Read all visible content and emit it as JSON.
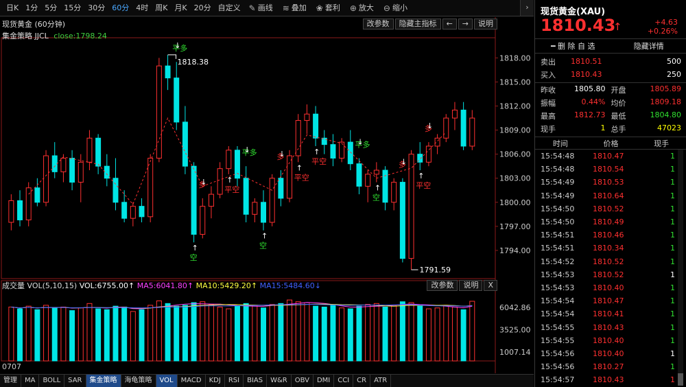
{
  "toolbar": {
    "periods": [
      "日K",
      "1分",
      "5分",
      "15分",
      "30分",
      "60分",
      "4时",
      "周K",
      "月K",
      "20分",
      "自定义"
    ],
    "active_period": "60分",
    "tools": [
      {
        "label": "画线",
        "icon": "pencil-icon"
      },
      {
        "label": "叠加",
        "icon": "layers-icon"
      },
      {
        "label": "套利",
        "icon": "bag-icon"
      },
      {
        "label": "放大",
        "icon": "zoom-in-icon"
      },
      {
        "label": "缩小",
        "icon": "zoom-out-icon"
      }
    ],
    "collapse": "›"
  },
  "main_chart": {
    "title": "现货黄金 (60分钟)",
    "indicator_name": "集金策略 JJCL",
    "indicator_close": "close:1798.24",
    "buttons": [
      "改参数",
      "隐藏主指标",
      "←",
      "→",
      "说明"
    ],
    "high_label": "1818.38",
    "low_label": "1791.59",
    "signals": [
      {
        "text": "平多",
        "kind": "pingduo"
      },
      {
        "text": "空",
        "kind": "kong"
      },
      {
        "text": "多",
        "kind": "duo"
      },
      {
        "text": "平空",
        "kind": "pingkong"
      },
      {
        "text": "平多",
        "kind": "pingduo"
      },
      {
        "text": "空",
        "kind": "kong"
      },
      {
        "text": "多",
        "kind": "duo"
      },
      {
        "text": "平空",
        "kind": "pingkong"
      },
      {
        "text": "平空",
        "kind": "pingkong"
      },
      {
        "text": "平多",
        "kind": "pingduo"
      },
      {
        "text": "空",
        "kind": "kong"
      },
      {
        "text": "多",
        "kind": "duo"
      },
      {
        "text": "平空",
        "kind": "pingkong"
      },
      {
        "text": "多",
        "kind": "duo"
      }
    ]
  },
  "volume_panel": {
    "label": "成交量 VOL(5,10,15)",
    "vol": "VOL:6755.00↑",
    "ma5": "MA5:6041.80↑",
    "ma10": "MA10:5429.20↑",
    "ma15": "MA15:5484.60↓",
    "buttons": [
      "改参数",
      "说明",
      "X"
    ],
    "date": "0707"
  },
  "chart_data": [
    {
      "type": "candlestick",
      "title": "现货黄金 (60分钟)",
      "y_ticks": [
        "1818.00",
        "1815.00",
        "1812.00",
        "1809.00",
        "1806.00",
        "1803.00",
        "1800.00",
        "1797.00",
        "1794.00"
      ],
      "ylim": [
        1791,
        1820
      ],
      "annotations": [
        "1818.38",
        "1791.59"
      ],
      "ohlc": [
        [
          1797.5,
          1801.0,
          1796.5,
          1800.2
        ],
        [
          1800.2,
          1801.5,
          1797.0,
          1797.8
        ],
        [
          1797.8,
          1802.5,
          1797.0,
          1801.8
        ],
        [
          1801.8,
          1803.0,
          1799.5,
          1800.0
        ],
        [
          1800.0,
          1806.5,
          1799.5,
          1805.8
        ],
        [
          1805.8,
          1807.5,
          1803.0,
          1803.8
        ],
        [
          1803.8,
          1806.0,
          1802.5,
          1805.5
        ],
        [
          1805.5,
          1806.5,
          1801.5,
          1802.5
        ],
        [
          1802.5,
          1806.0,
          1800.0,
          1805.0
        ],
        [
          1805.0,
          1809.0,
          1804.0,
          1808.0
        ],
        [
          1808.0,
          1808.5,
          1803.5,
          1804.5
        ],
        [
          1804.5,
          1806.0,
          1802.0,
          1803.0
        ],
        [
          1803.0,
          1805.5,
          1799.0,
          1800.0
        ],
        [
          1800.0,
          1801.5,
          1797.5,
          1798.0
        ],
        [
          1798.0,
          1800.0,
          1797.0,
          1799.5
        ],
        [
          1799.5,
          1800.5,
          1797.5,
          1798.2
        ],
        [
          1798.2,
          1806.0,
          1797.5,
          1805.5
        ],
        [
          1805.5,
          1818.0,
          1805.0,
          1817.0
        ],
        [
          1817.0,
          1818.38,
          1814.0,
          1815.5
        ],
        [
          1815.5,
          1817.5,
          1809.0,
          1810.0
        ],
        [
          1810.0,
          1812.0,
          1803.5,
          1804.5
        ],
        [
          1804.5,
          1805.0,
          1795.0,
          1796.0
        ],
        [
          1796.0,
          1800.5,
          1795.5,
          1799.5
        ],
        [
          1799.5,
          1802.0,
          1798.0,
          1801.0
        ],
        [
          1801.0,
          1805.0,
          1800.5,
          1804.2
        ],
        [
          1804.2,
          1807.0,
          1803.5,
          1806.5
        ],
        [
          1806.5,
          1807.0,
          1802.0,
          1803.0
        ],
        [
          1803.0,
          1804.5,
          1797.5,
          1798.5
        ],
        [
          1798.5,
          1800.5,
          1797.5,
          1800.0
        ],
        [
          1800.0,
          1801.5,
          1796.5,
          1797.5
        ],
        [
          1797.5,
          1803.5,
          1797.0,
          1803.0
        ],
        [
          1803.0,
          1804.0,
          1799.5,
          1800.5
        ],
        [
          1800.5,
          1806.5,
          1800.0,
          1805.8
        ],
        [
          1805.8,
          1811.0,
          1805.0,
          1810.2
        ],
        [
          1810.2,
          1812.2,
          1808.5,
          1811.0
        ],
        [
          1811.0,
          1812.0,
          1807.0,
          1808.0
        ],
        [
          1808.0,
          1809.0,
          1806.0,
          1807.2
        ],
        [
          1807.2,
          1808.5,
          1804.5,
          1805.5
        ],
        [
          1805.5,
          1808.0,
          1805.0,
          1807.5
        ],
        [
          1807.5,
          1809.0,
          1804.0,
          1804.8
        ],
        [
          1804.8,
          1805.5,
          1801.0,
          1802.0
        ],
        [
          1802.0,
          1804.0,
          1800.0,
          1803.5
        ],
        [
          1803.5,
          1805.0,
          1802.5,
          1804.0
        ],
        [
          1804.0,
          1804.5,
          1799.0,
          1800.0
        ],
        [
          1800.0,
          1803.0,
          1799.0,
          1802.5
        ],
        [
          1802.5,
          1803.0,
          1792.5,
          1793.0
        ],
        [
          1793.0,
          1806.5,
          1791.59,
          1806.0
        ],
        [
          1806.0,
          1807.5,
          1804.0,
          1805.0
        ],
        [
          1805.0,
          1807.5,
          1804.5,
          1807.0
        ],
        [
          1807.0,
          1808.5,
          1806.0,
          1808.0
        ],
        [
          1808.0,
          1811.0,
          1807.5,
          1810.5
        ],
        [
          1810.5,
          1812.5,
          1809.0,
          1811.5
        ],
        [
          1811.5,
          1812.5,
          1806.5,
          1807.0
        ],
        [
          1807.0,
          1811.5,
          1806.5,
          1810.5
        ]
      ]
    },
    {
      "type": "bar",
      "title": "成交量 VOL(5,10,15)",
      "y_ticks": [
        "6042.86",
        "3525.00",
        "1007.14"
      ],
      "ylim": [
        0,
        8000
      ],
      "values": [
        6100,
        5900,
        6200,
        5800,
        6300,
        6000,
        6100,
        5700,
        6000,
        6500,
        5900,
        5800,
        6200,
        6100,
        5600,
        5800,
        6300,
        6800,
        6500,
        6200,
        6300,
        6600,
        6700,
        6400,
        6100,
        5900,
        6200,
        6500,
        6300,
        6000,
        6400,
        6500,
        6900,
        6700,
        6600,
        6200,
        6100,
        6300,
        6000,
        5900,
        6200,
        6400,
        6500,
        6100,
        6300,
        6700,
        6600,
        6200,
        5900,
        6000,
        6300,
        6100,
        5800,
        6755
      ]
    }
  ],
  "quote_panel": {
    "title": "现货黄金(XAU)",
    "price": "1810.43",
    "arrow": "↑",
    "change": "+4.63",
    "change_pct": "+0.26%",
    "actions": [
      "━ 删 除 自 选",
      "隐藏详情"
    ],
    "sell_label": "卖出",
    "sell_price": "1810.51",
    "sell_vol": "500",
    "buy_label": "买入",
    "buy_price": "1810.43",
    "buy_vol": "250",
    "prev_close_label": "昨收",
    "prev_close": "1805.80",
    "open_label": "开盘",
    "open": "1805.89",
    "amplitude_label": "振幅",
    "amplitude": "0.44%",
    "avg_label": "均价",
    "avg": "1809.18",
    "high_label": "最高",
    "high": "1812.73",
    "low_label": "最低",
    "low": "1804.80",
    "cur_vol_label": "现手",
    "cur_vol": "1",
    "total_vol_label": "总手",
    "total_vol": "47023"
  },
  "ticks": {
    "headers": [
      "时间",
      "价格",
      "现手"
    ],
    "rows": [
      {
        "time": "15:54:48",
        "price": "1810.47",
        "vol": "1",
        "dir": "up"
      },
      {
        "time": "15:54:48",
        "price": "1810.54",
        "vol": "1",
        "dir": "up"
      },
      {
        "time": "15:54:49",
        "price": "1810.53",
        "vol": "1",
        "dir": "up"
      },
      {
        "time": "15:54:49",
        "price": "1810.64",
        "vol": "1",
        "dir": "up"
      },
      {
        "time": "15:54:50",
        "price": "1810.52",
        "vol": "1",
        "dir": "up"
      },
      {
        "time": "15:54:50",
        "price": "1810.49",
        "vol": "1",
        "dir": "up"
      },
      {
        "time": "15:54:51",
        "price": "1810.46",
        "vol": "1",
        "dir": "up"
      },
      {
        "time": "15:54:51",
        "price": "1810.34",
        "vol": "1",
        "dir": "up"
      },
      {
        "time": "15:54:52",
        "price": "1810.52",
        "vol": "1",
        "dir": "up"
      },
      {
        "time": "15:54:53",
        "price": "1810.52",
        "vol": "1",
        "dir": "flat"
      },
      {
        "time": "15:54:53",
        "price": "1810.40",
        "vol": "1",
        "dir": "up"
      },
      {
        "time": "15:54:54",
        "price": "1810.47",
        "vol": "1",
        "dir": "up"
      },
      {
        "time": "15:54:54",
        "price": "1810.41",
        "vol": "1",
        "dir": "up"
      },
      {
        "time": "15:54:55",
        "price": "1810.43",
        "vol": "1",
        "dir": "up"
      },
      {
        "time": "15:54:55",
        "price": "1810.40",
        "vol": "1",
        "dir": "up"
      },
      {
        "time": "15:54:56",
        "price": "1810.40",
        "vol": "1",
        "dir": "flat"
      },
      {
        "time": "15:54:56",
        "price": "1810.27",
        "vol": "1",
        "dir": "up"
      },
      {
        "time": "15:54:57",
        "price": "1810.43",
        "vol": "1",
        "dir": "down"
      }
    ]
  },
  "bottom_tabs": [
    "管理",
    "MA",
    "BOLL",
    "SAR",
    "集金策略",
    "海龟策略",
    "VOL",
    "MACD",
    "KDJ",
    "RSI",
    "BIAS",
    "W&R",
    "OBV",
    "DMI",
    "CCI",
    "CR",
    "ATR"
  ],
  "bottom_tabs_highlight": [
    "集金策略",
    "VOL"
  ],
  "colors": {
    "up": "#ff3030",
    "down": "#00e5e5",
    "ma5": "#ff40ff",
    "ma10": "#ffff40",
    "ma15": "#4060ff",
    "accent": "#4aa8ff"
  }
}
